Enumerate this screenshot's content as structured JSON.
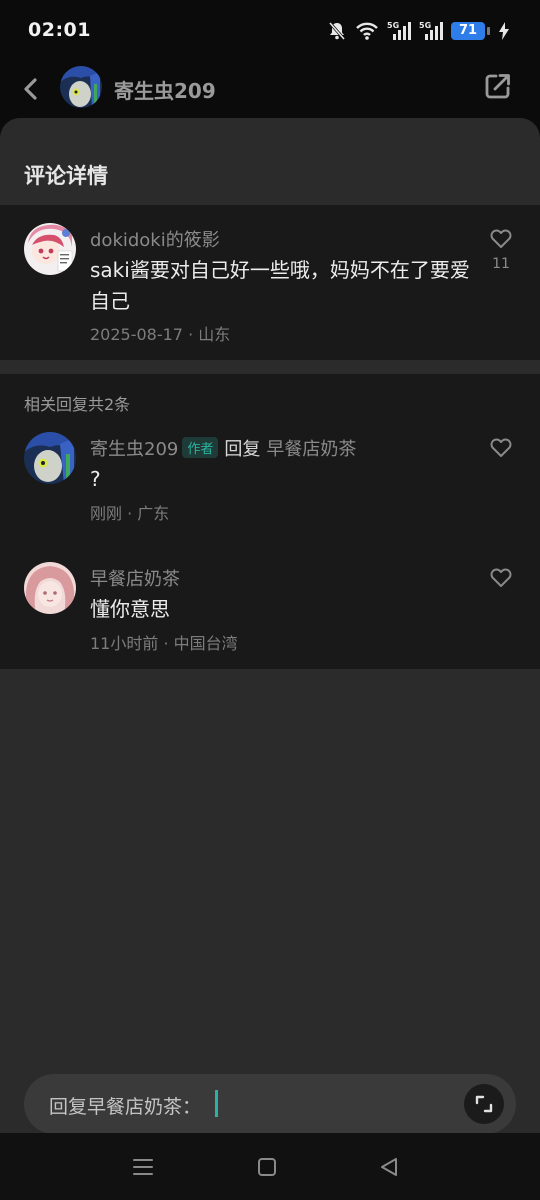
{
  "status_bar": {
    "time": "02:01",
    "battery": "71"
  },
  "header": {
    "title": "寄生虫209"
  },
  "sheet": {
    "title": "评论详情"
  },
  "main_comment": {
    "username": "dokidoki的筱影",
    "text": "saki酱要对自己好一些哦，妈妈不在了要爱自己",
    "date_location": "2025-08-17 · 山东",
    "likes": "11"
  },
  "replies_section": {
    "count_label": "相关回复共2条",
    "replies": [
      {
        "username": "寄生虫209",
        "badge": "作者",
        "reply_word": "回复",
        "reply_target": "早餐店奶茶",
        "text": "?",
        "time_location": "刚刚 · 广东"
      },
      {
        "username": "早餐店奶茶",
        "text": "懂你意思",
        "time_location": "11小时前 · 中国台湾"
      }
    ]
  },
  "input": {
    "placeholder": "回复早餐店奶茶："
  },
  "colors": {
    "accent": "#2ab3a5",
    "sheet_bg": "#2b2b2b",
    "card_bg": "#191919",
    "battery": "#2f7de8"
  }
}
